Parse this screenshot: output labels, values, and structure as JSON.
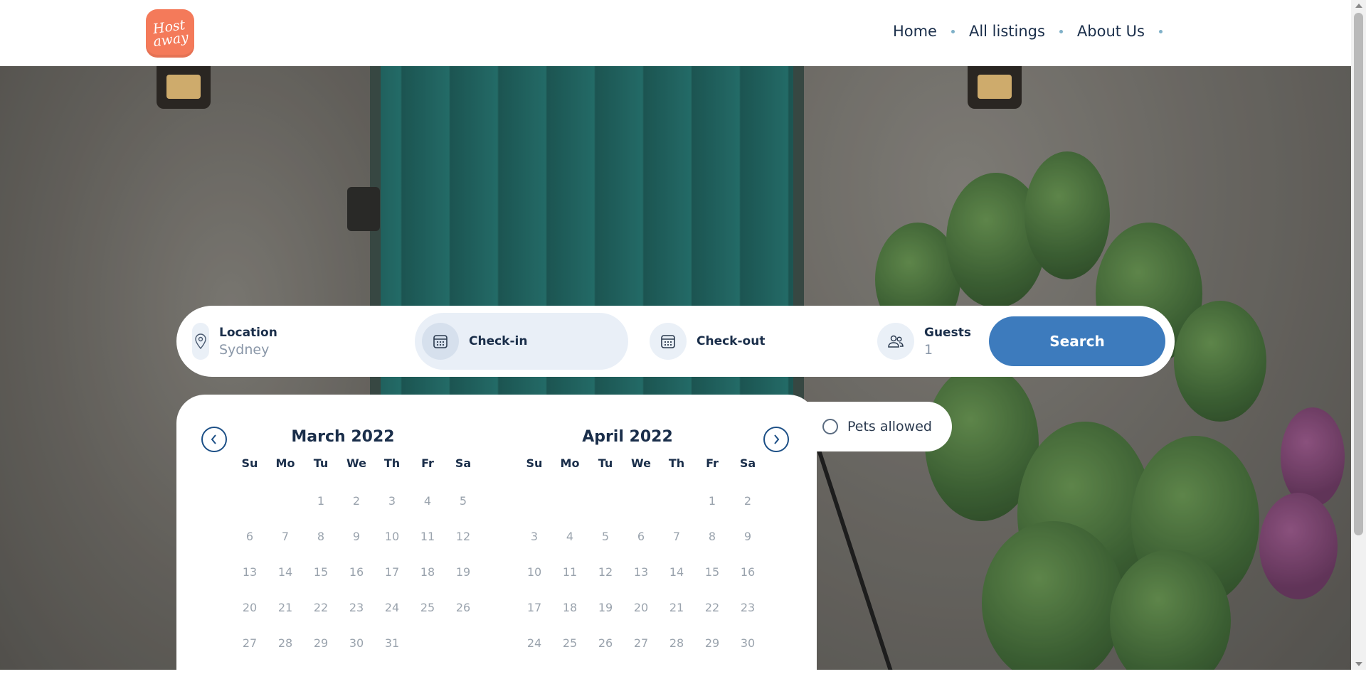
{
  "brand": {
    "logo_text_line1": "Host",
    "logo_text_line2": "away",
    "accent": "#f47a5a"
  },
  "nav": {
    "items": [
      "Home",
      "All listings",
      "About Us"
    ]
  },
  "search": {
    "location": {
      "label": "Location",
      "value": "Sydney",
      "icon": "map-pin-icon"
    },
    "checkin": {
      "label": "Check-in",
      "icon": "calendar-icon"
    },
    "checkout": {
      "label": "Check-out",
      "icon": "calendar-icon"
    },
    "guests": {
      "label": "Guests",
      "value": "1",
      "icon": "users-icon"
    },
    "button_label": "Search",
    "button_color": "#3d7bbd"
  },
  "filters": {
    "pets_label": "Pets allowed",
    "pets_checked": false
  },
  "calendar": {
    "weekdays": [
      "Su",
      "Mo",
      "Tu",
      "We",
      "Th",
      "Fr",
      "Sa"
    ],
    "months": [
      {
        "title": "March 2022",
        "weeks": [
          [
            "",
            "",
            "1",
            "2",
            "3",
            "4",
            "5"
          ],
          [
            "6",
            "7",
            "8",
            "9",
            "10",
            "11",
            "12"
          ],
          [
            "13",
            "14",
            "15",
            "16",
            "17",
            "18",
            "19"
          ],
          [
            "20",
            "21",
            "22",
            "23",
            "24",
            "25",
            "26"
          ],
          [
            "27",
            "28",
            "29",
            "30",
            "31",
            "",
            ""
          ]
        ]
      },
      {
        "title": "April 2022",
        "weeks": [
          [
            "",
            "",
            "",
            "",
            "",
            "1",
            "2"
          ],
          [
            "3",
            "4",
            "5",
            "6",
            "7",
            "8",
            "9"
          ],
          [
            "10",
            "11",
            "12",
            "13",
            "14",
            "15",
            "16"
          ],
          [
            "17",
            "18",
            "19",
            "20",
            "21",
            "22",
            "23"
          ],
          [
            "24",
            "25",
            "26",
            "27",
            "28",
            "29",
            "30"
          ]
        ]
      }
    ]
  }
}
